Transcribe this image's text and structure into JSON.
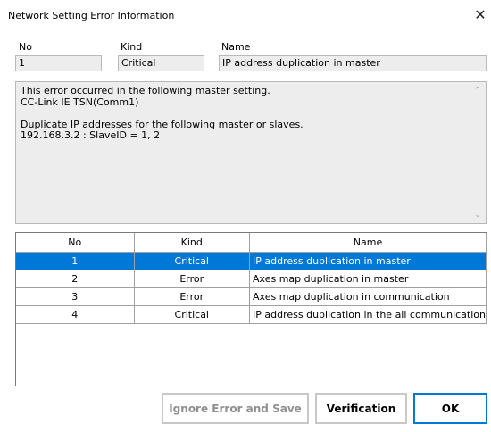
{
  "window": {
    "title": "Network Setting Error Information",
    "close_glyph": "✕"
  },
  "header": {
    "no_label": "No",
    "kind_label": "Kind",
    "name_label": "Name",
    "no_value": "1",
    "kind_value": "Critical",
    "name_value": "IP address duplication in master"
  },
  "details": {
    "lines": [
      "This error occurred in the following master setting.",
      "CC-Link IE TSN(Comm1)",
      "",
      "Duplicate IP addresses for the following master or slaves.",
      "192.168.3.2 : SlaveID = 1, 2"
    ]
  },
  "table": {
    "columns": [
      "No",
      "Kind",
      "Name"
    ],
    "rows": [
      {
        "no": "1",
        "kind": "Critical",
        "name": "IP address duplication in master",
        "selected": true
      },
      {
        "no": "2",
        "kind": "Error",
        "name": "Axes map duplication in master",
        "selected": false
      },
      {
        "no": "3",
        "kind": "Error",
        "name": "Axes map duplication in communication",
        "selected": false
      },
      {
        "no": "4",
        "kind": "Critical",
        "name": "IP address duplication in the all communication",
        "selected": false
      }
    ]
  },
  "buttons": {
    "ignore_save": "Ignore Error and Save",
    "verification": "Verification",
    "ok": "OK"
  },
  "colors": {
    "selection": "#0078d7",
    "field_bg": "#ededed",
    "disabled_text": "#8f8f8f"
  }
}
